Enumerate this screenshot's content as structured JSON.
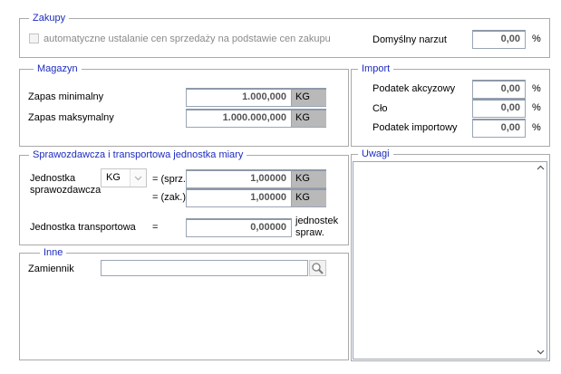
{
  "zakupy": {
    "legend": "Zakupy",
    "auto_price_label": "automatyczne ustalanie cen sprzedaży na podstawie cen zakupu",
    "markup_label": "Domyślny narzut",
    "markup_value": "0,00",
    "markup_unit": "%"
  },
  "magazyn": {
    "legend": "Magazyn",
    "min_label": "Zapas minimalny",
    "min_value": "1.000,000",
    "min_unit": "KG",
    "max_label": "Zapas maksymalny",
    "max_value": "1.000.000,000",
    "max_unit": "KG"
  },
  "import": {
    "legend": "Import",
    "excise_label": "Podatek akcyzowy",
    "excise_value": "0,00",
    "duty_label": "Cło",
    "duty_value": "0,00",
    "import_tax_label": "Podatek importowy",
    "import_tax_value": "0,00",
    "unit": "%"
  },
  "reporting": {
    "legend": "Sprawozdawcza i transportowa jednostka miary",
    "unit_label_line1": "Jednostka",
    "unit_label_line2": "sprawozdawcza",
    "unit_selected": "KG",
    "sales_label": "= (sprz.)",
    "sales_value": "1,00000",
    "sales_unit": "KG",
    "purchase_label": "= (zak.)",
    "purchase_value": "1,00000",
    "purchase_unit": "KG",
    "transport_label": "Jednostka transportowa",
    "transport_eq": "=",
    "transport_value": "0,00000",
    "transport_unit_line1": "jednostek",
    "transport_unit_line2": "spraw."
  },
  "inne": {
    "legend": "Inne",
    "substitute_label": "Zamiennik",
    "substitute_value": ""
  },
  "uwagi": {
    "legend": "Uwagi",
    "notes_value": ""
  }
}
